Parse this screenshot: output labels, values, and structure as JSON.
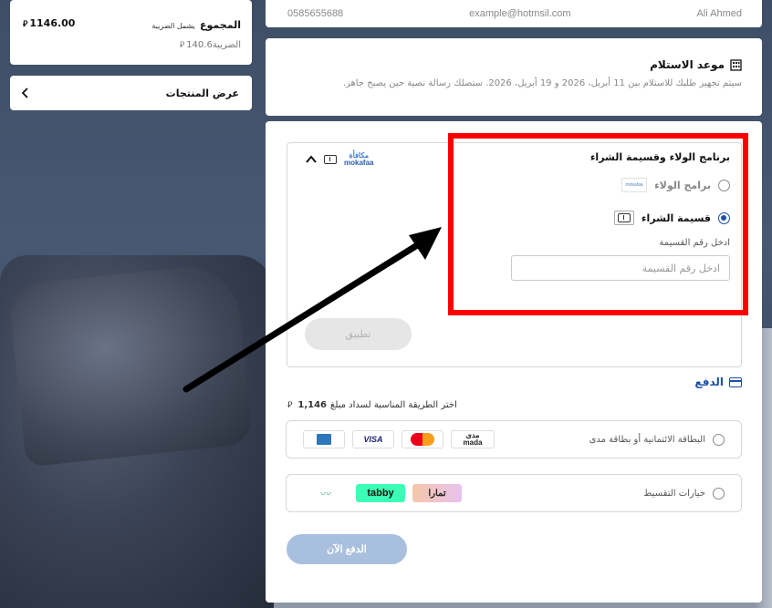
{
  "summary": {
    "total_label": "المجموع",
    "total_note": "يشمل الضريبة",
    "total_value": "1146.00",
    "tax_label": "الضريبة",
    "tax_value": "140.6",
    "currency_icon": "riyal-icon"
  },
  "products_button": {
    "label": "عرض المنتجات"
  },
  "contact": {
    "name": "Ali Ahmed",
    "email": "example@hotmsil.com",
    "phone": "0585655688"
  },
  "pickup": {
    "title": "موعد الاستلام",
    "description": "سيتم تجهيز طلبك للاستلام بين 11 أبريل، 2026 و 19 أبريل، 2026. ستصلك رسالة نصية حين يصبح جاهز."
  },
  "loyalty": {
    "mokafaa_ar": "مكافأة",
    "mokafaa_en": "mokafaa",
    "title": "برنامج الولاء وقسيمة الشراء",
    "option_loyalty": "برامج الولاء",
    "option_coupon": "قسيمة الشراء",
    "coupon_input_label": "ادخل رقم القسيمة",
    "coupon_placeholder": "ادخل رقم القسيمة",
    "apply_label": "تطبيق",
    "selected": "coupon"
  },
  "payment": {
    "heading": "الدفع",
    "amount": "1,146",
    "instruction": "اختر الطريقة المناسبة لسداد مبلغ",
    "card_option": "البطاقة الائتمانية أو بطاقة مدى",
    "card_logos": [
      "amex",
      "VISA",
      "mastercard",
      "mada"
    ],
    "mada_ar": "مدى",
    "mada_en": "mada",
    "visa_text": "VISA",
    "installment_option": "خيارات التقسيط",
    "tabby_text": "tabby",
    "tamara_text": "تمارا",
    "pay_now": "الدفع الآن"
  },
  "colors": {
    "accent": "#1e4fa3",
    "highlight": "#ff0000",
    "pay_button": "#a9bfde"
  }
}
